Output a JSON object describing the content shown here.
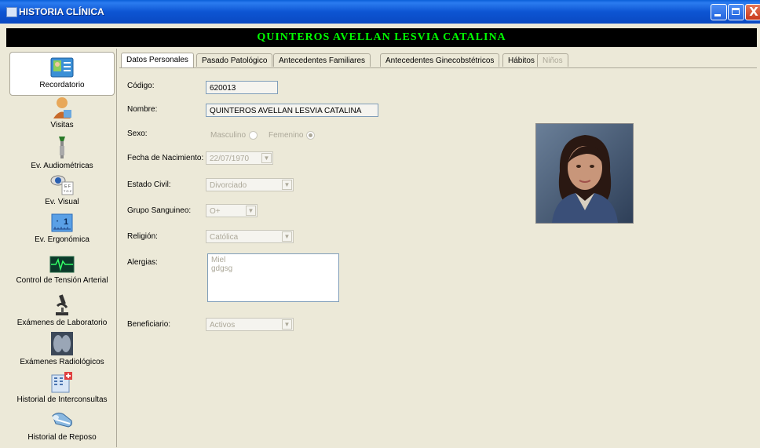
{
  "window": {
    "title": "HISTORIA CLÍNICA",
    "close_glyph": "X"
  },
  "patient": {
    "name": "QUINTEROS  AVELLAN LESVIA CATALINA"
  },
  "sidebar": {
    "items": [
      {
        "label": "Recordatorio",
        "icon": "id-card-icon",
        "active": true
      },
      {
        "label": "Visitas",
        "icon": "user-visit-icon"
      },
      {
        "label": "Ev. Audiométricas",
        "icon": "audiometry-icon"
      },
      {
        "label": "Ev. Visual",
        "icon": "eye-chart-icon"
      },
      {
        "label": "Ev. Ergonómica",
        "icon": "ruler-icon"
      },
      {
        "label": "Control de Tensión Arterial",
        "icon": "heart-monitor-icon"
      },
      {
        "label": "Exámenes  de Laboratorio",
        "icon": "microscope-icon"
      },
      {
        "label": "Exámenes Radiológicos",
        "icon": "xray-icon"
      },
      {
        "label": "Historial de Interconsultas",
        "icon": "hospital-icon"
      },
      {
        "label": "Historial de Reposo",
        "icon": "bed-icon"
      }
    ]
  },
  "tabs": [
    {
      "label": "Datos Personales",
      "active": true
    },
    {
      "label": "Pasado Patológico"
    },
    {
      "label": "Antecedentes  Familiares"
    },
    {
      "label": "Antecedentes Ginecobstétricos"
    },
    {
      "label": "Hábitos"
    },
    {
      "label": "Niños",
      "disabled": true
    }
  ],
  "form": {
    "codigo": {
      "label": "Código:",
      "value": "620013"
    },
    "nombre": {
      "label": "Nombre:",
      "value": "QUINTEROS  AVELLAN LESVIA CATALINA"
    },
    "sexo": {
      "label": "Sexo:",
      "options": [
        "Masculino",
        "Femenino"
      ],
      "selected": "Femenino"
    },
    "fecha_nacimiento": {
      "label": "Fecha de Nacimiento:",
      "value": "22/07/1970"
    },
    "estado_civil": {
      "label": "Estado Civil:",
      "value": "Divorciado"
    },
    "grupo_sanguineo": {
      "label": "Grupo Sanguineo:",
      "value": "O+"
    },
    "religion": {
      "label": "Religión:",
      "value": "Católica"
    },
    "alergias": {
      "label": "Alergias:",
      "lines": [
        "Miel",
        "gdgsg"
      ]
    },
    "beneficiario": {
      "label": "Beneficiario:",
      "value": "Activos"
    }
  },
  "colors": {
    "title_bar": "#0a5fd8",
    "patient_bar_bg": "#000000",
    "patient_bar_text": "#00ff00",
    "window_bg": "#ece9d8"
  }
}
